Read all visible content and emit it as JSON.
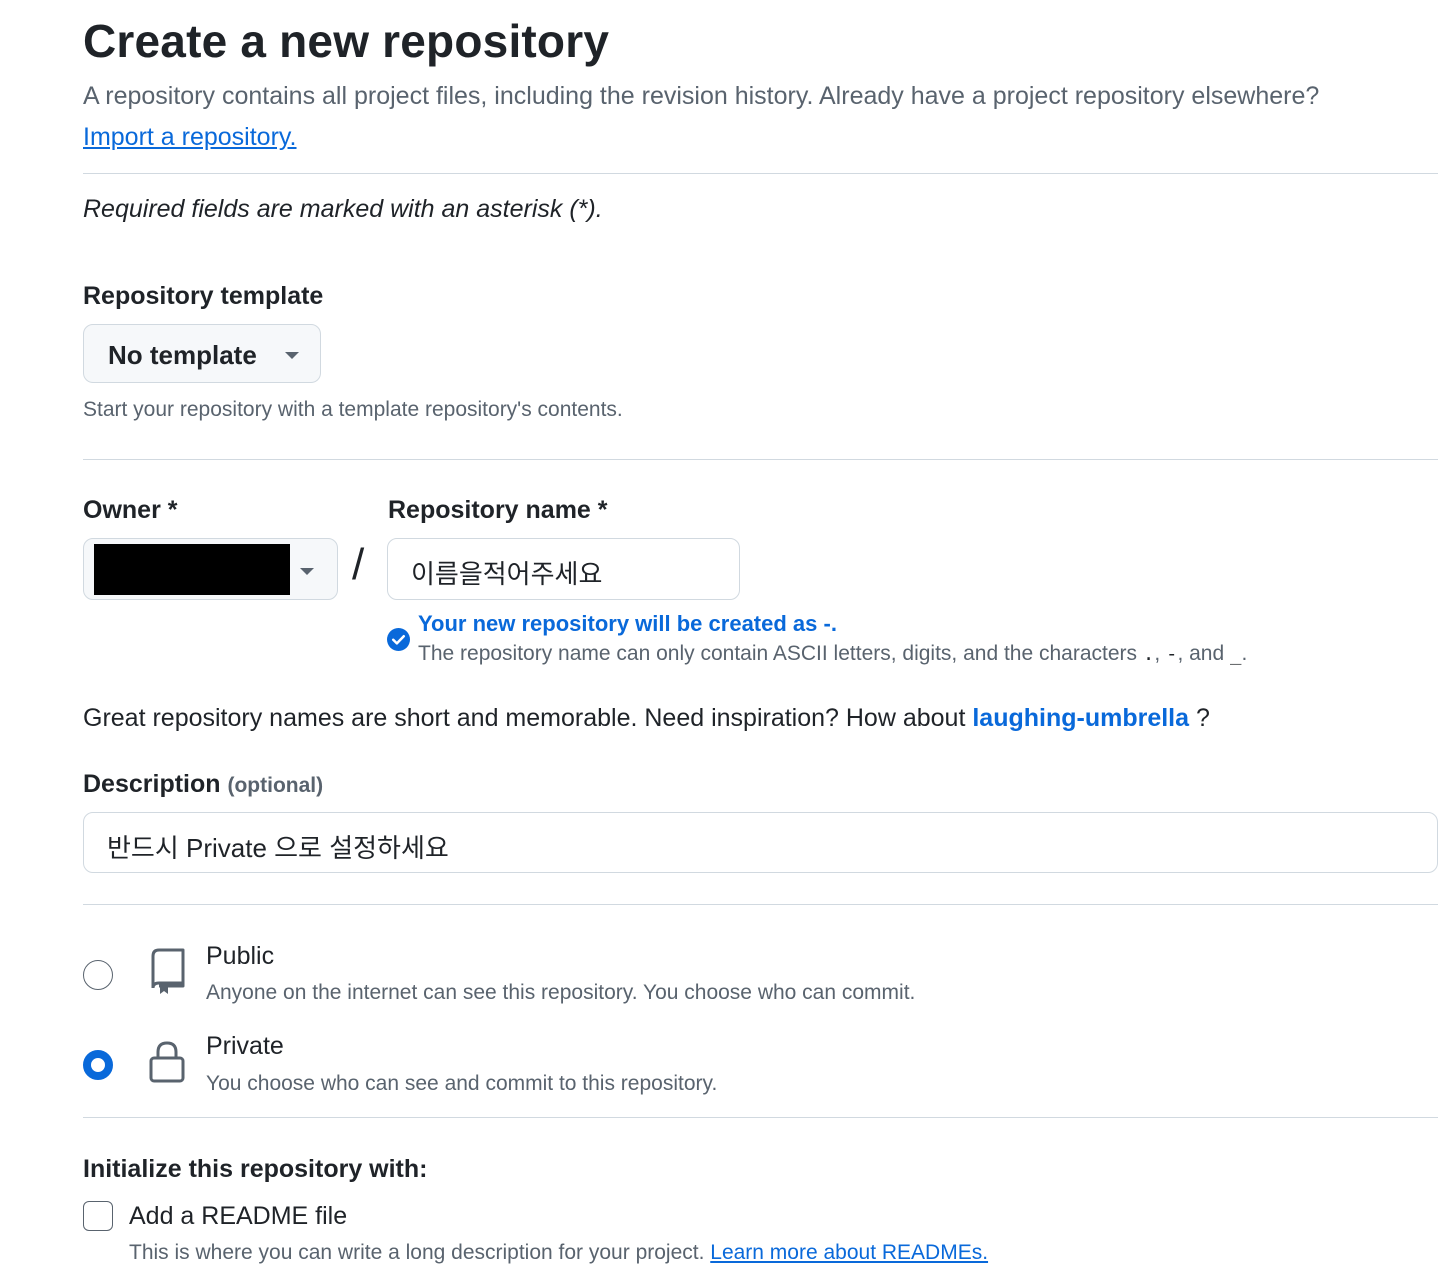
{
  "header": {
    "title": "Create a new repository",
    "subtitle": "A repository contains all project files, including the revision history. Already have a project repository elsewhere?",
    "import_link": "Import a repository."
  },
  "required_note": "Required fields are marked with an asterisk (*).",
  "template": {
    "label": "Repository template",
    "selected": "No template",
    "hint": "Start your repository with a template repository's contents."
  },
  "owner": {
    "label": "Owner *"
  },
  "slash": "/",
  "repo_name": {
    "label": "Repository name *",
    "value": "이름을적어주세요",
    "valid_message": "Your new repository will be created as -.",
    "rule_prefix": "The repository name can only contain ASCII letters, digits, and the characters ",
    "rule_char1": ".",
    "rule_sep1": ", ",
    "rule_char2": "-",
    "rule_sep2": ", and ",
    "rule_char3": "_",
    "rule_end": "."
  },
  "inspiration": {
    "prefix": "Great repository names are short and memorable. Need inspiration? How about ",
    "suggestion": "laughing-umbrella",
    "suffix": " ?"
  },
  "description": {
    "label": "Description",
    "optional": "(optional)",
    "value": "반드시 Private 으로 설정하세요"
  },
  "visibility": {
    "public": {
      "title": "Public",
      "desc": "Anyone on the internet can see this repository. You choose who can commit.",
      "icon": "repo-icon",
      "selected": false
    },
    "private": {
      "title": "Private",
      "desc": "You choose who can see and commit to this repository.",
      "icon": "lock-icon",
      "selected": true
    }
  },
  "initialize": {
    "label": "Initialize this repository with:",
    "readme_label": "Add a README file",
    "readme_checked": false,
    "readme_desc": "This is where you can write a long description for your project. ",
    "readme_link": "Learn more about READMEs."
  },
  "colors": {
    "accent": "#0969da",
    "text": "#1f2328",
    "muted": "#59636e",
    "border": "#d1d9e0"
  }
}
